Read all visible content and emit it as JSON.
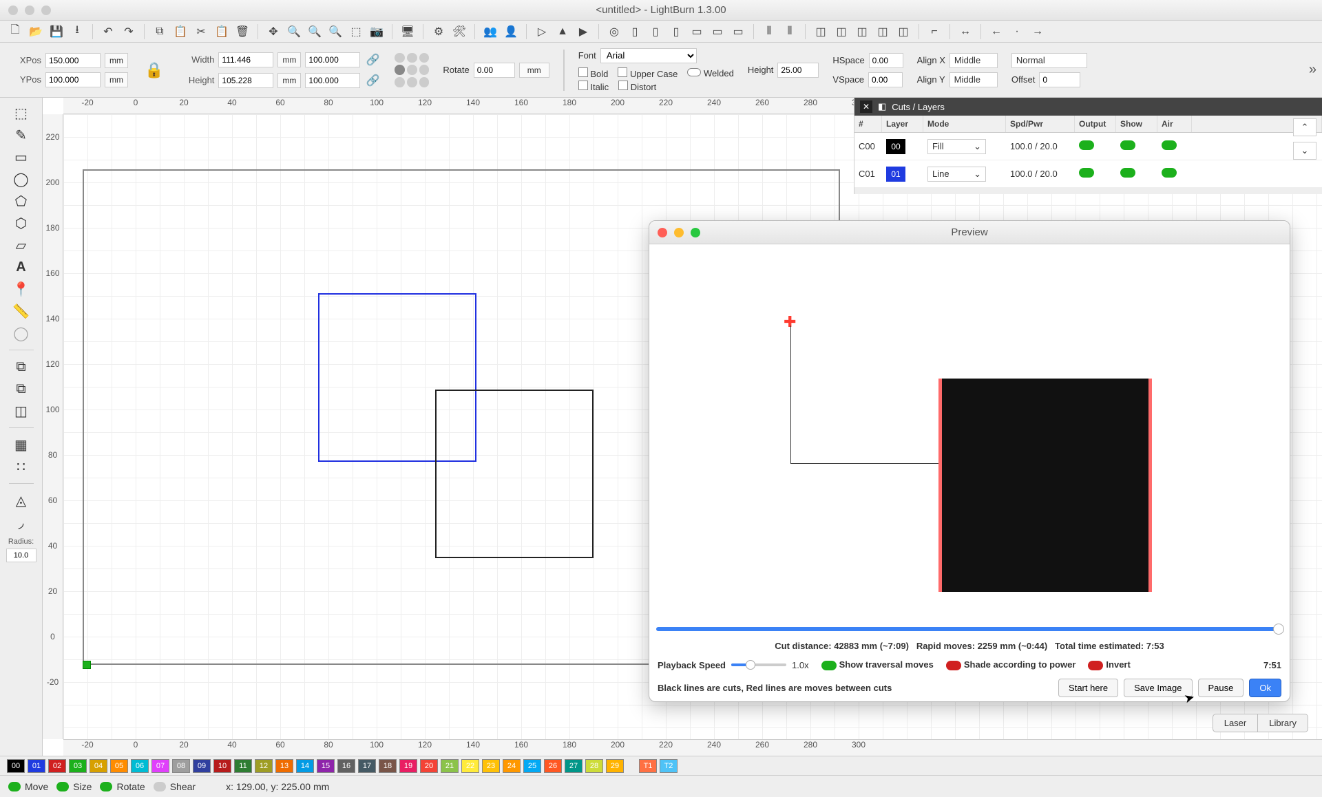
{
  "window": {
    "title": "<untitled> - LightBurn 1.3.00"
  },
  "position": {
    "xpos_label": "XPos",
    "xpos": "150.000",
    "ypos_label": "YPos",
    "ypos": "100.000",
    "width_label": "Width",
    "width": "111.446",
    "height_label": "Height",
    "height": "105.228",
    "pct_w": "100.000",
    "pct_h": "100.000",
    "unit": "mm",
    "rotate_label": "Rotate",
    "rotate": "0.00",
    "mm_btn": "mm"
  },
  "font_panel": {
    "font_label": "Font",
    "font": "Arial",
    "bold": "Bold",
    "italic": "Italic",
    "upper": "Upper Case",
    "distort": "Distort",
    "welded": "Welded",
    "height_label": "Height",
    "height": "25.00",
    "hspace_label": "HSpace",
    "hspace": "0.00",
    "vspace_label": "VSpace",
    "vspace": "0.00",
    "alignx_label": "Align X",
    "alignx": "Middle",
    "aligny_label": "Align Y",
    "aligny": "Middle",
    "normal": "Normal",
    "offset_label": "Offset",
    "offset": "0"
  },
  "side_tools": {
    "radius_label": "Radius:",
    "radius": "10.0"
  },
  "ruler_top": [
    "-20",
    "0",
    "20",
    "40",
    "60",
    "80",
    "100",
    "120",
    "140",
    "160",
    "180",
    "200",
    "220",
    "240",
    "260",
    "280",
    "300"
  ],
  "ruler_left": [
    "220",
    "200",
    "180",
    "160",
    "140",
    "120",
    "100",
    "80",
    "60",
    "40",
    "20",
    "0",
    "-20"
  ],
  "cuts": {
    "title": "Cuts / Layers",
    "headers": {
      "num": "#",
      "layer": "Layer",
      "mode": "Mode",
      "spdpwr": "Spd/Pwr",
      "output": "Output",
      "show": "Show",
      "air": "Air"
    },
    "rows": [
      {
        "id": "C00",
        "layer_num": "00",
        "layer_color": "#000000",
        "mode": "Fill",
        "spdpwr": "100.0 / 20.0"
      },
      {
        "id": "C01",
        "layer_num": "01",
        "layer_color": "#1f3be0",
        "mode": "Line",
        "spdpwr": "100.0 / 20.0"
      }
    ]
  },
  "swatches": [
    {
      "n": "00",
      "c": "#000000"
    },
    {
      "n": "01",
      "c": "#1f3be0"
    },
    {
      "n": "02",
      "c": "#d02020"
    },
    {
      "n": "03",
      "c": "#1cb01c"
    },
    {
      "n": "04",
      "c": "#d7a000"
    },
    {
      "n": "05",
      "c": "#ff8c00"
    },
    {
      "n": "06",
      "c": "#00bcd4"
    },
    {
      "n": "07",
      "c": "#e040fb"
    },
    {
      "n": "08",
      "c": "#9e9e9e"
    },
    {
      "n": "09",
      "c": "#303f9f"
    },
    {
      "n": "10",
      "c": "#b71c1c"
    },
    {
      "n": "11",
      "c": "#2e7d32"
    },
    {
      "n": "12",
      "c": "#9e9d24"
    },
    {
      "n": "13",
      "c": "#ef6c00"
    },
    {
      "n": "14",
      "c": "#039be5"
    },
    {
      "n": "15",
      "c": "#8e24aa"
    },
    {
      "n": "16",
      "c": "#616161"
    },
    {
      "n": "17",
      "c": "#455a64"
    },
    {
      "n": "18",
      "c": "#795548"
    },
    {
      "n": "19",
      "c": "#e91e63"
    },
    {
      "n": "20",
      "c": "#f44336"
    },
    {
      "n": "21",
      "c": "#8bc34a"
    },
    {
      "n": "22",
      "c": "#ffeb3b"
    },
    {
      "n": "23",
      "c": "#ffc107"
    },
    {
      "n": "24",
      "c": "#ff9800"
    },
    {
      "n": "25",
      "c": "#03a9f4"
    },
    {
      "n": "26",
      "c": "#ff5722"
    },
    {
      "n": "27",
      "c": "#009688"
    },
    {
      "n": "28",
      "c": "#cddc39"
    },
    {
      "n": "29",
      "c": "#ffb300"
    }
  ],
  "tool_layers": [
    {
      "n": "T1",
      "c": "#ff7043"
    },
    {
      "n": "T2",
      "c": "#4fc3f7"
    }
  ],
  "status": {
    "move": "Move",
    "size": "Size",
    "rotate": "Rotate",
    "shear": "Shear",
    "coords": "x: 129.00, y: 225.00 mm"
  },
  "preview": {
    "title": "Preview",
    "info_cut": "Cut distance: 42883 mm (~7:09)",
    "info_rapid": "Rapid moves: 2259 mm (~0:44)",
    "info_total": "Total time estimated: 7:53",
    "playback_label": "Playback Speed",
    "playback_speed": "1.0x",
    "show_traversal": "Show traversal moves",
    "shade_power": "Shade according to power",
    "invert": "Invert",
    "elapsed": "7:51",
    "hint": "Black lines are cuts, Red lines are moves between cuts",
    "btn_start": "Start here",
    "btn_save": "Save Image",
    "btn_pause": "Pause",
    "btn_ok": "Ok"
  },
  "tabs": {
    "laser": "Laser",
    "library": "Library"
  }
}
